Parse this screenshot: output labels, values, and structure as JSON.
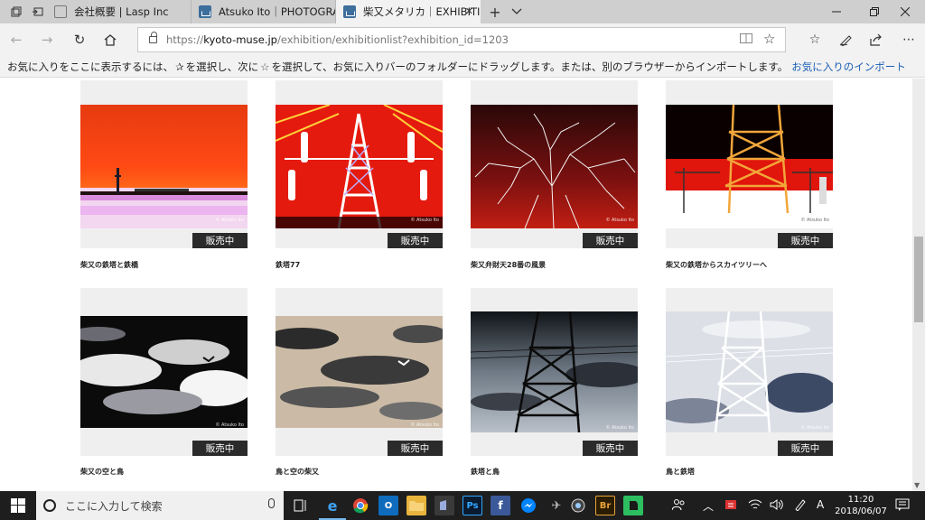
{
  "browser": {
    "tabs": [
      {
        "title": "会社概要 | Lasp Inc",
        "active": false
      },
      {
        "title": "Atsuko Ito｜PHOTOGRAPHI",
        "active": false
      },
      {
        "title": "柴又メタリカ｜EXHIBITIO",
        "active": true
      }
    ],
    "url_prefix": "https://",
    "url_host": "kyoto-muse.jp",
    "url_path": "/exhibition/exhibitionlist?exhibition_id=1203",
    "favorites_message_1": "お気に入りをここに表示するには、",
    "favorites_message_2": "を選択し、次に",
    "favorites_message_3": "を選択して、お気に入りバーのフォルダーにドラッグします。または、別のブラウザーからインポートします。",
    "favorites_import_link": "お気に入りのインポート"
  },
  "gallery": {
    "sale_label": "販売中",
    "credit": "© Atsuko Ito",
    "items": [
      {
        "title": "柴又の鉄塔と鉄橋"
      },
      {
        "title": "鉄塔77"
      },
      {
        "title": "柴又弁財天28番の風景"
      },
      {
        "title": "柴又の鉄塔からスカイツリーへ"
      },
      {
        "title": "柴又の空と鳥"
      },
      {
        "title": "鳥と空の柴又"
      },
      {
        "title": "鉄塔と鳥"
      },
      {
        "title": "鳥と鉄塔"
      }
    ]
  },
  "taskbar": {
    "search_placeholder": "ここに入力して検索",
    "clock_time": "11:20",
    "clock_date": "2018/06/07",
    "ime_label": "A",
    "apps": [
      "edge",
      "chrome",
      "outlook",
      "explorer",
      "photoshop-alt",
      "photoshop",
      "facebook",
      "messenger",
      "camera",
      "media",
      "bridge",
      "evernote"
    ]
  },
  "colors": {
    "accent_link": "#1a5fb4",
    "badge_bg": "#2b2b2b",
    "taskbar_bg": "#1e1e1e"
  }
}
